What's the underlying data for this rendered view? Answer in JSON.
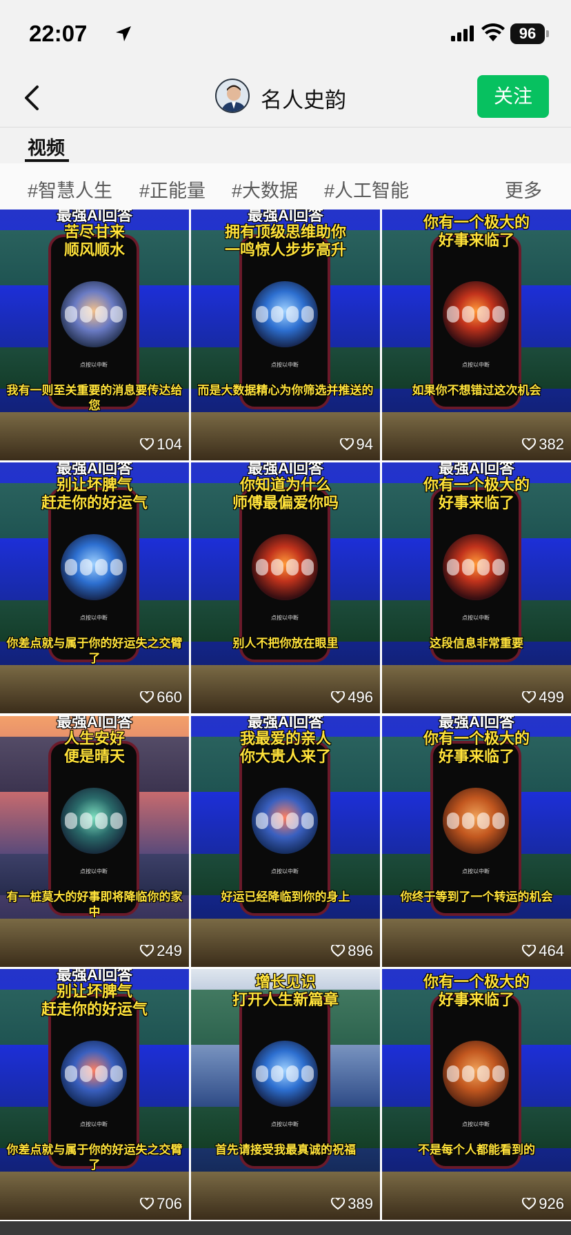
{
  "status": {
    "time": "22:07",
    "battery": "96"
  },
  "nav": {
    "name": "名人史韵",
    "follow": "关注"
  },
  "tabs": {
    "active": "视频"
  },
  "tags": [
    "#智慧人生",
    "#正能量",
    "#大数据",
    "#人工智能"
  ],
  "more": "更多",
  "tap_hint": "点按以中断",
  "tiles": [
    {
      "title_white": "最强AI回答",
      "title_yellow": "苦尽甘来\n顺风顺水",
      "caption": "我有一则至关重要的消息要传达给您",
      "likes": "104",
      "circle": "dusk",
      "bg": ""
    },
    {
      "title_white": "最强AI回答",
      "title_yellow": "拥有顶级思维助你\n一鸣惊人步步高升",
      "caption": "而是大数据精心为你筛选并推送的",
      "likes": "94",
      "circle": "blue",
      "bg": ""
    },
    {
      "title_white": "",
      "title_yellow": "你有一个极大的\n好事来临了",
      "caption": "如果你不想错过这次机会",
      "likes": "382",
      "circle": "",
      "bg": ""
    },
    {
      "title_white": "最强AI回答",
      "title_yellow": "别让坏脾气\n赶走你的好运气",
      "caption": "你差点就与属于你的好运失之交臂了",
      "likes": "660",
      "circle": "blue",
      "bg": ""
    },
    {
      "title_white": "最强AI回答",
      "title_yellow": "你知道为什么\n师傅最偏爱你吗",
      "caption": "别人不把你放在眼里",
      "likes": "496",
      "circle": "",
      "bg": ""
    },
    {
      "title_white": "最强AI回答",
      "title_yellow": "你有一个极大的\n好事来临了",
      "caption": "这段信息非常重要",
      "likes": "499",
      "circle": "",
      "bg": ""
    },
    {
      "title_white": "最强AI回答",
      "title_yellow": "人生安好\n便是晴天",
      "caption": "有一桩莫大的好事即将降临你的家中",
      "likes": "249",
      "circle": "jade",
      "bg": "city"
    },
    {
      "title_white": "最强AI回答",
      "title_yellow": "我最爱的亲人\n你大贵人来了",
      "caption": "好运已经降临到你的身上",
      "likes": "896",
      "circle": "koi",
      "bg": ""
    },
    {
      "title_white": "最强AI回答",
      "title_yellow": "你有一个极大的\n好事来临了",
      "caption": "你终于等到了一个转运的机会",
      "likes": "464",
      "circle": "gold",
      "bg": ""
    },
    {
      "title_white": "最强AI回答",
      "title_yellow": "别让坏脾气\n赶走你的好运气",
      "caption": "你差点就与属于你的好运失之交臂了",
      "likes": "706",
      "circle": "koi",
      "bg": ""
    },
    {
      "title_white": "",
      "title_yellow": "增长见识\n打开人生新篇章",
      "caption": "首先请接受我最真诚的祝福",
      "likes": "389",
      "circle": "blue",
      "bg": "cloud"
    },
    {
      "title_white": "",
      "title_yellow": "你有一个极大的\n好事来临了",
      "caption": "不是每个人都能看到的",
      "likes": "926",
      "circle": "gold",
      "bg": ""
    }
  ],
  "colors": {
    "accent": "#07c160",
    "caption": "#ffe23a"
  }
}
